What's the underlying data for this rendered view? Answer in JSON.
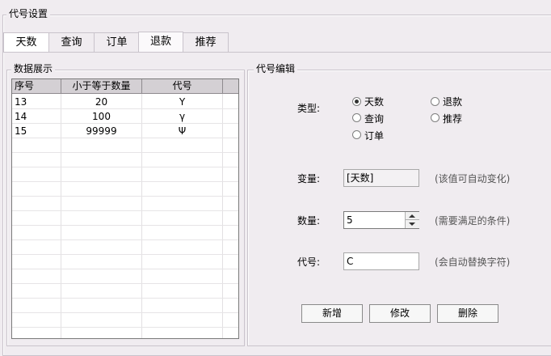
{
  "window": {
    "title": "代号设置"
  },
  "tabs": [
    {
      "label": "天数"
    },
    {
      "label": "查询"
    },
    {
      "label": "订单"
    },
    {
      "label": "退款"
    },
    {
      "label": "推荐"
    }
  ],
  "data_panel": {
    "title": "数据展示",
    "columns": [
      "序号",
      "小于等于数量",
      "代号"
    ],
    "rows": [
      {
        "id": "13",
        "qty": "20",
        "code": "Υ"
      },
      {
        "id": "14",
        "qty": "100",
        "code": "γ"
      },
      {
        "id": "15",
        "qty": "99999",
        "code": "Ψ"
      }
    ]
  },
  "edit_panel": {
    "title": "代号编辑",
    "type_label": "类型:",
    "type_options": [
      {
        "label": "天数",
        "selected": true
      },
      {
        "label": "退款",
        "selected": false
      },
      {
        "label": "查询",
        "selected": false
      },
      {
        "label": "推荐",
        "selected": false
      },
      {
        "label": "订单",
        "selected": false
      }
    ],
    "variable_label": "变量:",
    "variable_value": "[天数]",
    "variable_hint": "(该值可自动变化)",
    "quantity_label": "数量:",
    "quantity_value": "5",
    "quantity_hint": "(需要满足的条件)",
    "code_label": "代号:",
    "code_value": "C",
    "code_hint": "(会自动替换字符)",
    "buttons": {
      "add": "新增",
      "modify": "修改",
      "delete": "删除"
    }
  }
}
